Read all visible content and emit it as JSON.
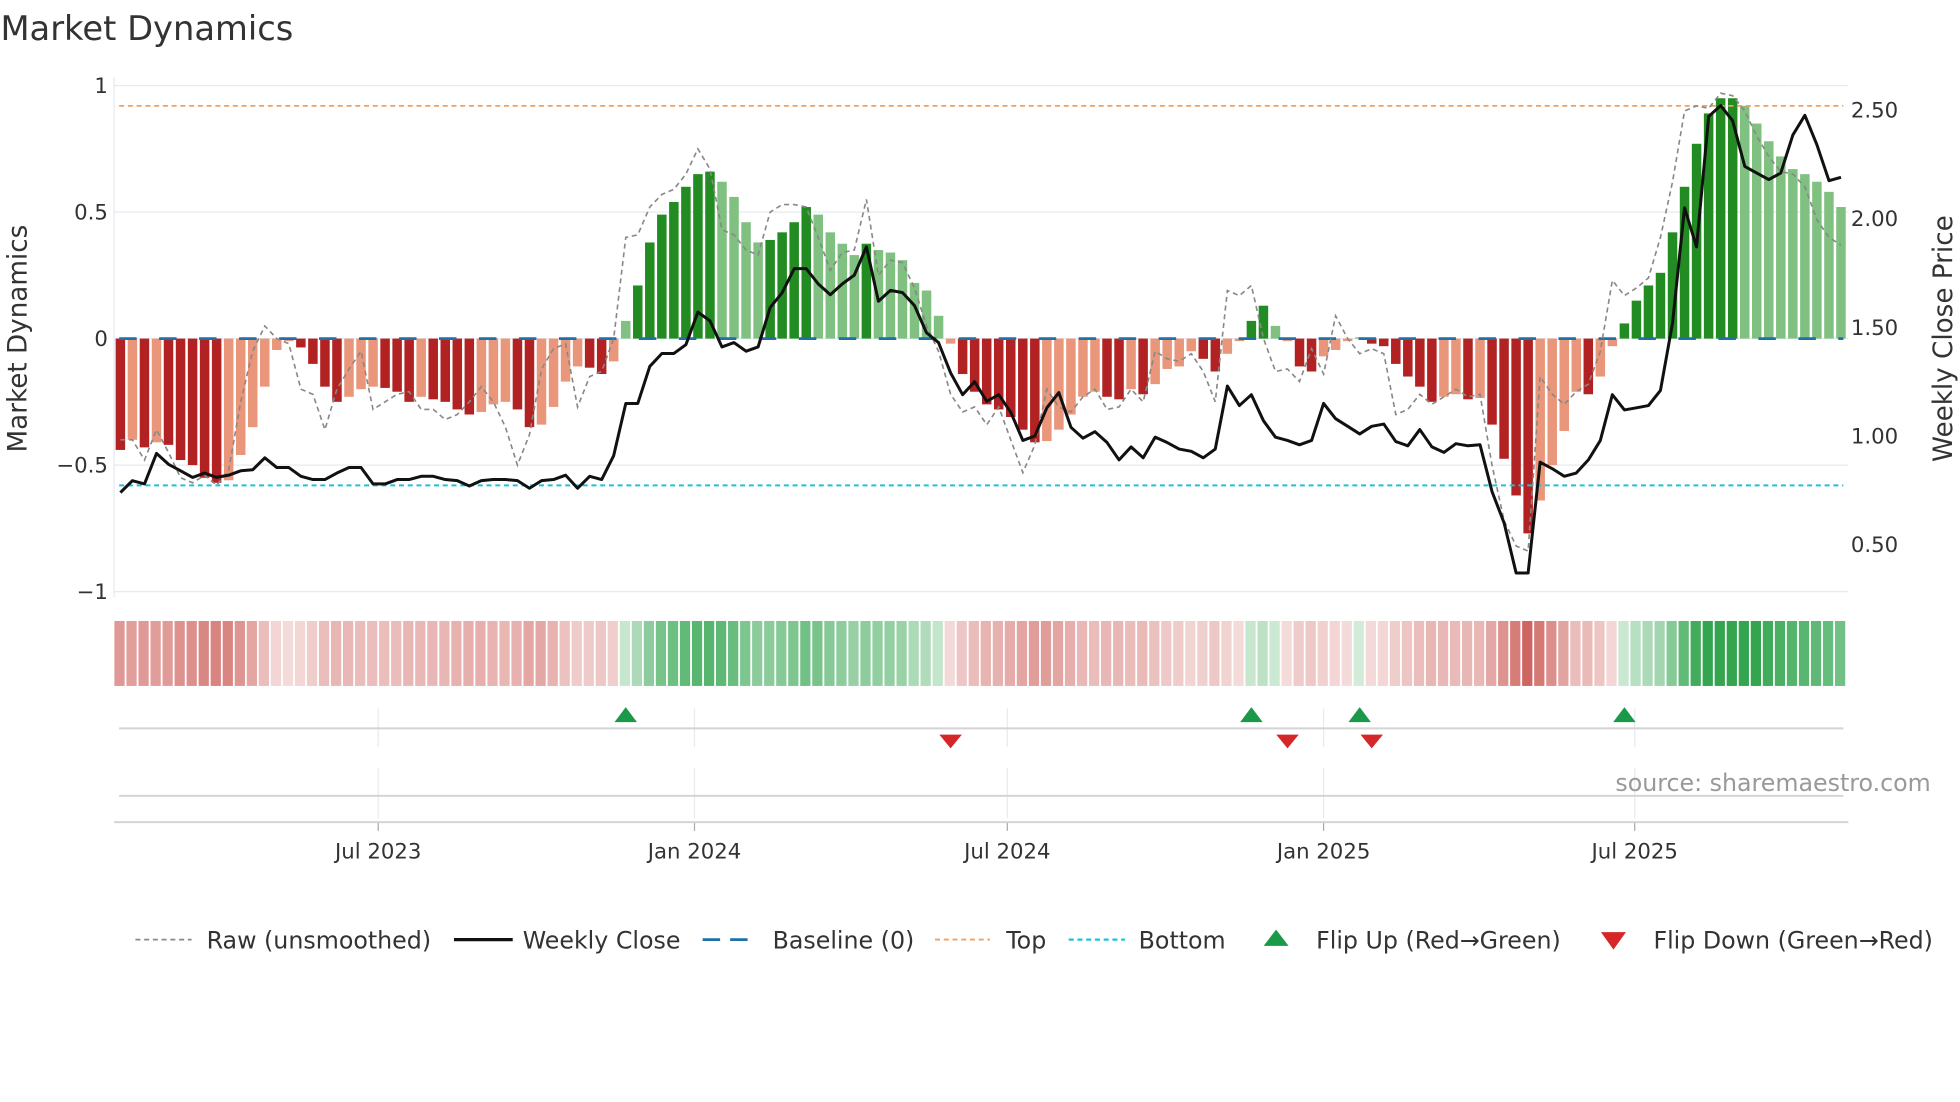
{
  "title": "Market Dynamics",
  "source": "source: sharemaestro.com",
  "chart_data": {
    "type": "bar+line",
    "title": "Market Dynamics",
    "ylabel": "Market Dynamics",
    "ylabel_right": "Weekly Close Price",
    "x_start": "2023-02-01",
    "x_step_days": 7,
    "ylim": [
      -1,
      1
    ],
    "ylim_right": [
      0.28,
      2.61
    ],
    "grid": true,
    "legend_position": "bottom",
    "left_ticks": [
      {
        "v": 1,
        "label": "1"
      },
      {
        "v": 0.5,
        "label": "0.5"
      },
      {
        "v": 0,
        "label": "0"
      },
      {
        "v": -0.5,
        "label": "−0.5"
      },
      {
        "v": -1,
        "label": "−1"
      }
    ],
    "right_ticks": [
      {
        "v": 2.5,
        "label": "2.50"
      },
      {
        "v": 2.0,
        "label": "2.00"
      },
      {
        "v": 1.5,
        "label": "1.50"
      },
      {
        "v": 1.0,
        "label": "1.00"
      },
      {
        "v": 0.5,
        "label": "0.50"
      }
    ],
    "x_ticks": [
      {
        "date": "2023-07-01",
        "label": "Jul 2023"
      },
      {
        "date": "2024-01-01",
        "label": "Jan 2024"
      },
      {
        "date": "2024-07-01",
        "label": "Jul 2024"
      },
      {
        "date": "2025-01-01",
        "label": "Jan 2025"
      },
      {
        "date": "2025-07-01",
        "label": "Jul 2025"
      }
    ],
    "top_level": 0.92,
    "bottom_level": -0.58,
    "baseline": 0,
    "momentum": [
      -0.44,
      -0.4,
      -0.43,
      -0.41,
      -0.42,
      -0.48,
      -0.5,
      -0.55,
      -0.57,
      -0.56,
      -0.46,
      -0.35,
      -0.19,
      -0.045,
      -0.01,
      -0.035,
      -0.1,
      -0.19,
      -0.25,
      -0.23,
      -0.2,
      -0.19,
      -0.195,
      -0.21,
      -0.25,
      -0.23,
      -0.24,
      -0.25,
      -0.28,
      -0.3,
      -0.29,
      -0.26,
      -0.25,
      -0.28,
      -0.35,
      -0.34,
      -0.27,
      -0.17,
      -0.11,
      -0.115,
      -0.14,
      -0.09,
      0.07,
      0.21,
      0.38,
      0.49,
      0.54,
      0.6,
      0.65,
      0.66,
      0.62,
      0.56,
      0.46,
      0.38,
      0.39,
      0.42,
      0.46,
      0.52,
      0.49,
      0.42,
      0.375,
      0.33,
      0.375,
      0.35,
      0.34,
      0.31,
      0.22,
      0.19,
      0.09,
      -0.02,
      -0.14,
      -0.21,
      -0.26,
      -0.28,
      -0.31,
      -0.36,
      -0.41,
      -0.405,
      -0.36,
      -0.3,
      -0.23,
      -0.21,
      -0.23,
      -0.24,
      -0.2,
      -0.22,
      -0.18,
      -0.12,
      -0.11,
      -0.05,
      -0.08,
      -0.13,
      -0.06,
      -0.01,
      0.07,
      0.13,
      0.05,
      -0.01,
      -0.11,
      -0.13,
      -0.07,
      -0.045,
      -0.01,
      0.005,
      -0.02,
      -0.03,
      -0.1,
      -0.15,
      -0.19,
      -0.25,
      -0.23,
      -0.22,
      -0.24,
      -0.235,
      -0.34,
      -0.475,
      -0.62,
      -0.77,
      -0.64,
      -0.5,
      -0.365,
      -0.21,
      -0.22,
      -0.15,
      -0.03,
      0.06,
      0.15,
      0.21,
      0.26,
      0.42,
      0.6,
      0.77,
      0.89,
      0.95,
      0.95,
      0.92,
      0.85,
      0.78,
      0.72,
      0.67,
      0.65,
      0.62,
      0.58,
      0.52
    ],
    "raw": [
      -0.4,
      -0.4,
      -0.48,
      -0.36,
      -0.45,
      -0.55,
      -0.57,
      -0.54,
      -0.58,
      -0.52,
      -0.25,
      -0.05,
      0.05,
      0.0,
      -0.02,
      -0.2,
      -0.22,
      -0.36,
      -0.2,
      -0.12,
      -0.05,
      -0.28,
      -0.25,
      -0.22,
      -0.21,
      -0.28,
      -0.28,
      -0.32,
      -0.3,
      -0.25,
      -0.19,
      -0.25,
      -0.35,
      -0.5,
      -0.38,
      -0.12,
      -0.04,
      -0.02,
      -0.27,
      -0.15,
      -0.13,
      0.0,
      0.4,
      0.41,
      0.52,
      0.57,
      0.59,
      0.65,
      0.75,
      0.67,
      0.43,
      0.41,
      0.35,
      0.33,
      0.5,
      0.53,
      0.53,
      0.52,
      0.4,
      0.27,
      0.34,
      0.35,
      0.55,
      0.25,
      0.31,
      0.3,
      0.2,
      0.05,
      -0.05,
      -0.22,
      -0.29,
      -0.27,
      -0.34,
      -0.27,
      -0.4,
      -0.53,
      -0.42,
      -0.2,
      -0.27,
      -0.29,
      -0.23,
      -0.2,
      -0.28,
      -0.27,
      -0.2,
      -0.25,
      -0.05,
      -0.08,
      -0.09,
      -0.06,
      -0.13,
      -0.25,
      0.19,
      0.17,
      0.21,
      0.0,
      -0.13,
      -0.12,
      -0.17,
      -0.04,
      -0.14,
      0.09,
      0.0,
      -0.06,
      -0.04,
      -0.06,
      -0.3,
      -0.28,
      -0.22,
      -0.26,
      -0.23,
      -0.2,
      -0.23,
      -0.22,
      -0.5,
      -0.72,
      -0.82,
      -0.84,
      -0.15,
      -0.22,
      -0.26,
      -0.21,
      -0.18,
      -0.05,
      0.23,
      0.17,
      0.2,
      0.24,
      0.4,
      0.62,
      0.9,
      0.92,
      0.91,
      0.97,
      0.96,
      0.9,
      0.8,
      0.72,
      0.66,
      0.65,
      0.6,
      0.47,
      0.4,
      0.37
    ],
    "close": [
      0.74,
      0.795,
      0.78,
      0.92,
      0.87,
      0.84,
      0.81,
      0.83,
      0.81,
      0.82,
      0.84,
      0.845,
      0.9,
      0.855,
      0.855,
      0.815,
      0.8,
      0.8,
      0.83,
      0.855,
      0.855,
      0.78,
      0.78,
      0.8,
      0.8,
      0.815,
      0.815,
      0.8,
      0.795,
      0.77,
      0.795,
      0.8,
      0.8,
      0.795,
      0.76,
      0.795,
      0.8,
      0.82,
      0.76,
      0.815,
      0.8,
      0.91,
      1.15,
      1.15,
      1.32,
      1.38,
      1.38,
      1.42,
      1.57,
      1.53,
      1.41,
      1.43,
      1.39,
      1.41,
      1.59,
      1.66,
      1.77,
      1.77,
      1.7,
      1.65,
      1.7,
      1.74,
      1.87,
      1.62,
      1.67,
      1.66,
      1.6,
      1.475,
      1.43,
      1.29,
      1.19,
      1.25,
      1.16,
      1.19,
      1.11,
      0.98,
      1.0,
      1.13,
      1.2,
      1.04,
      0.99,
      1.02,
      0.97,
      0.89,
      0.95,
      0.9,
      0.995,
      0.97,
      0.94,
      0.93,
      0.9,
      0.94,
      1.23,
      1.14,
      1.19,
      1.07,
      0.995,
      0.98,
      0.96,
      0.98,
      1.15,
      1.08,
      1.045,
      1.01,
      1.045,
      1.055,
      0.975,
      0.955,
      1.03,
      0.95,
      0.925,
      0.965,
      0.955,
      0.96,
      0.745,
      0.6,
      0.37,
      0.37,
      0.88,
      0.85,
      0.815,
      0.83,
      0.89,
      0.98,
      1.19,
      1.12,
      1.13,
      1.14,
      1.21,
      1.52,
      2.05,
      1.87,
      2.47,
      2.52,
      2.45,
      2.24,
      2.21,
      2.18,
      2.21,
      2.385,
      2.475,
      2.34,
      2.175,
      2.19
    ],
    "flip_up": [
      42,
      94,
      103,
      125
    ],
    "flip_down": [
      69,
      97,
      104
    ],
    "legend": {
      "raw": "Raw (unsmoothed)",
      "close": "Weekly Close",
      "baseline": "Baseline (0)",
      "top": "Top",
      "bottom": "Bottom",
      "flip_up": "Flip Up (Red→Green)",
      "flip_down": "Flip Down (Green→Red)"
    },
    "colors": {
      "red_strong": "#b22222",
      "red_weak": "#e9967a",
      "green_strong": "#228b22",
      "green_weak": "#80c080",
      "close": "#111111",
      "raw": "#888888",
      "baseline": "#1f6fa8",
      "top": "#f0a060",
      "bottom": "#22c0d8",
      "flip_up": "#1a9a48",
      "flip_down": "#d62728"
    }
  }
}
